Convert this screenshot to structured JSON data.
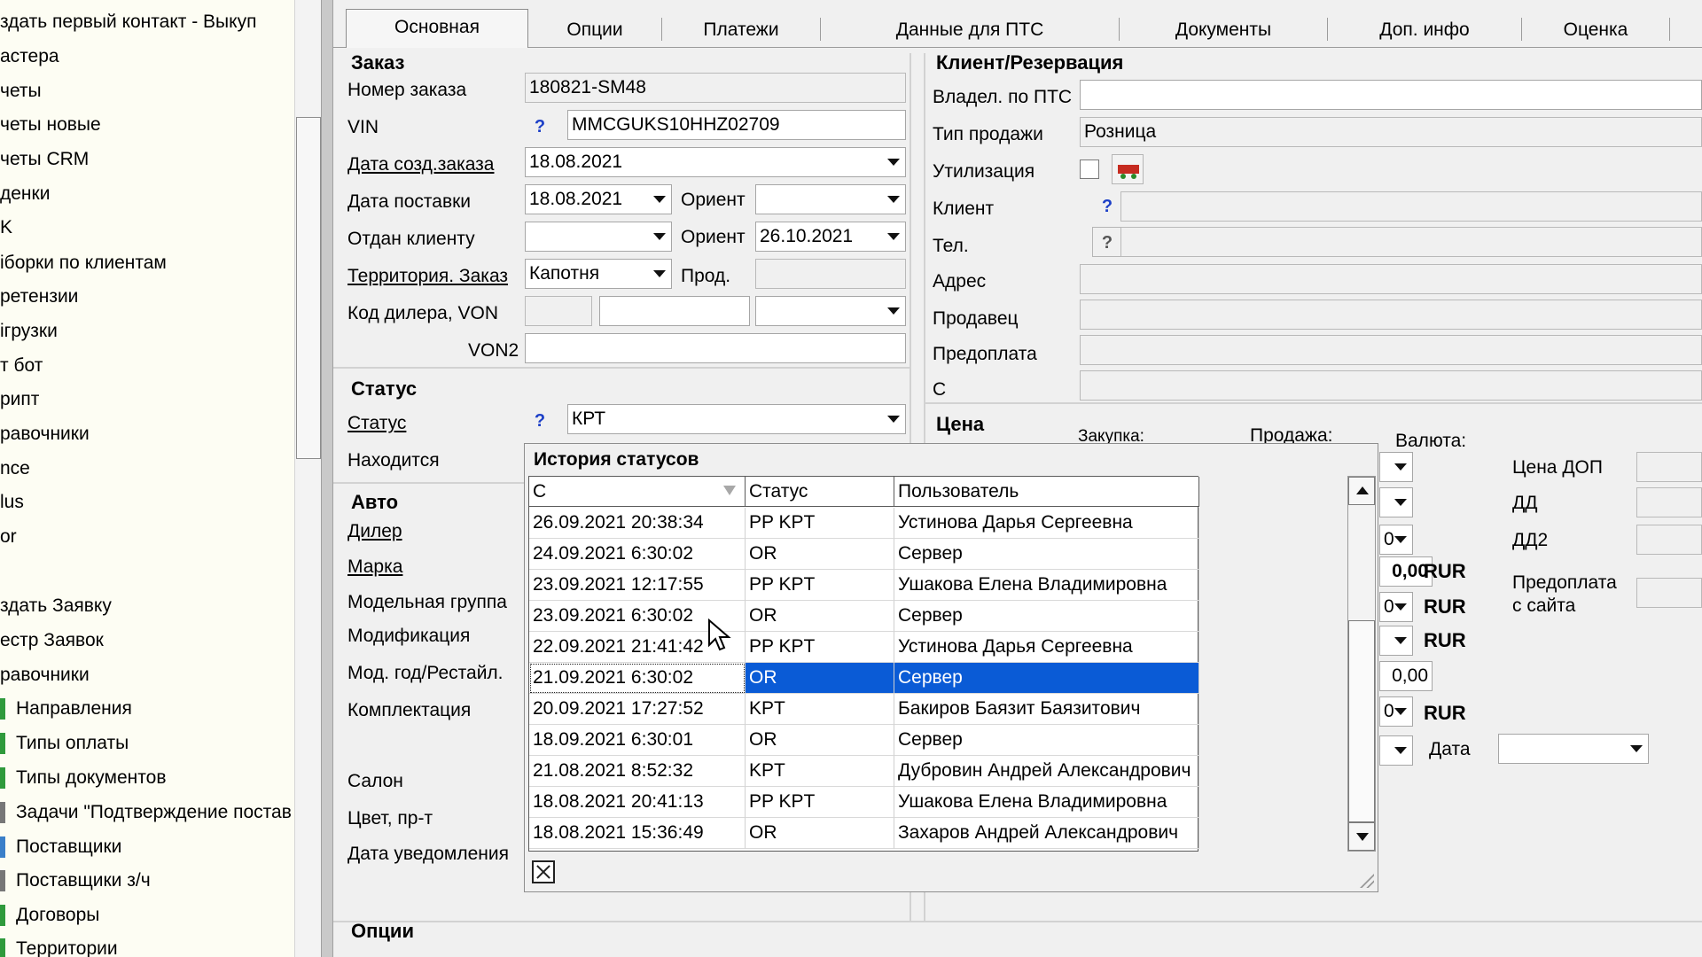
{
  "sidebar": {
    "items": [
      {
        "label": "здать первый контакт - Выкуп"
      },
      {
        "label": "астера"
      },
      {
        "label": "четы"
      },
      {
        "label": "четы новые"
      },
      {
        "label": "четы CRM"
      },
      {
        "label": "денки"
      },
      {
        "label": "K"
      },
      {
        "label": "iборки по клиентам"
      },
      {
        "label": "ретензии"
      },
      {
        "label": "ігрузки"
      },
      {
        "label": "т бот"
      },
      {
        "label": "рипт"
      },
      {
        "label": "равочники"
      },
      {
        "label": "nce"
      },
      {
        "label": "lus"
      },
      {
        "label": "or"
      },
      {
        "label": "здать Заявку"
      },
      {
        "label": "естр Заявок"
      },
      {
        "label": "равочники"
      },
      {
        "label": "Направления"
      },
      {
        "label": "Типы оплаты"
      },
      {
        "label": "Типы документов"
      },
      {
        "label": "Задачи \"Подтверждение постав"
      },
      {
        "label": "Поставщики"
      },
      {
        "label": "Поставщики з/ч"
      },
      {
        "label": "Договоры"
      },
      {
        "label": "Территории"
      }
    ]
  },
  "tabs": [
    {
      "label": "Основная"
    },
    {
      "label": "Опции"
    },
    {
      "label": "Платежи"
    },
    {
      "label": "Данные для ПТС"
    },
    {
      "label": "Документы"
    },
    {
      "label": "Доп. инфо"
    },
    {
      "label": "Оценка"
    }
  ],
  "order": {
    "section": "Заказ",
    "number_label": "Номер заказа",
    "number": "180821-SM48",
    "vin_label": "VIN",
    "vin": "MMCGUKS10HHZ02709",
    "created_label": "Дата созд.заказа",
    "created": "18.08.2021",
    "delivery_label": "Дата поставки",
    "delivery": "18.08.2021",
    "orient_label": "Ориент",
    "orient1": "",
    "handed_label": "Отдан клиенту",
    "handed": "",
    "orient2": "26.10.2021",
    "territory_label": "Территория. Заказ",
    "territory": "Капотня",
    "prod_label": "Прод.",
    "dealer_code_label": "Код дилера, VON",
    "von2_label": "VON2"
  },
  "status": {
    "section": "Статус",
    "status_label": "Статус",
    "status": "КРТ",
    "location_label": "Находится",
    "question": "?"
  },
  "auto": {
    "section": "Авто",
    "labels": {
      "dealer": "Дилер",
      "brand": "Марка",
      "model_group": "Модельная группа",
      "modification": "Модификация",
      "model_year": "Мод. год/Рестайл.",
      "equipment": "Комплектация",
      "salon": "Салон",
      "color": "Цвет, пр-т",
      "notify_date": "Дата уведомления"
    }
  },
  "options_section": "Опции",
  "client": {
    "section": "Клиент/Резервация",
    "owner_label": "Владел. по ПТС",
    "sale_type_label": "Тип продажи",
    "sale_type": "Розница",
    "recycling_label": "Утилизация",
    "client_label": "Клиент",
    "phone_label": "Тел.",
    "address_label": "Адрес",
    "seller_label": "Продавец",
    "prepay_label": "Предоплата",
    "c_label": "С"
  },
  "price": {
    "section": "Цена",
    "purchase_label": "Закупка:",
    "sale_label": "Продажа:",
    "currency_label": "Валюта:",
    "dop_label": "Цена ДОП",
    "dd_label": "ДД",
    "dd2_label": "ДД2",
    "site_prepay_label1": "Предоплата",
    "site_prepay_label2": "с сайта",
    "date_label": "Дата",
    "currency": "RUR",
    "partial_values": [
      "0,00",
      "0,00"
    ],
    "partial_digits": [
      "0",
      "0",
      "0"
    ]
  },
  "history": {
    "title": "История статусов",
    "columns": [
      "С",
      "Статус",
      "Пользователь"
    ],
    "rows": [
      {
        "date": "26.09.2021 20:38:34",
        "status": "PP KPT",
        "user": "Устинова Дарья Сергеевна"
      },
      {
        "date": "24.09.2021 6:30:02",
        "status": "OR",
        "user": "Сервер"
      },
      {
        "date": "23.09.2021 12:17:55",
        "status": "PP KPT",
        "user": "Ушакова Елена Владимировна"
      },
      {
        "date": "23.09.2021 6:30:02",
        "status": "OR",
        "user": "Сервер"
      },
      {
        "date": "22.09.2021 21:41:42",
        "status": "PP KPT",
        "user": "Устинова Дарья Сергеевна"
      },
      {
        "date": "21.09.2021 6:30:02",
        "status": "OR",
        "user": "Сервер"
      },
      {
        "date": "20.09.2021 17:27:52",
        "status": "KPT",
        "user": "Бакиров Баязит Баязитович"
      },
      {
        "date": "18.09.2021 6:30:01",
        "status": "OR",
        "user": "Сервер"
      },
      {
        "date": "21.08.2021 8:52:32",
        "status": "KPT",
        "user": "Дубровин Андрей Александрович"
      },
      {
        "date": "18.08.2021 20:41:13",
        "status": "PP KPT",
        "user": "Ушакова Елена Владимировна"
      },
      {
        "date": "18.08.2021 15:36:49",
        "status": "OR",
        "user": "Захаров Андрей Александрович"
      }
    ],
    "selected_index": 5
  },
  "colors": {
    "selection": "#0a5bd6",
    "sidebar_bg": "#fdfdf3",
    "window_bg": "#f0f0f0"
  }
}
